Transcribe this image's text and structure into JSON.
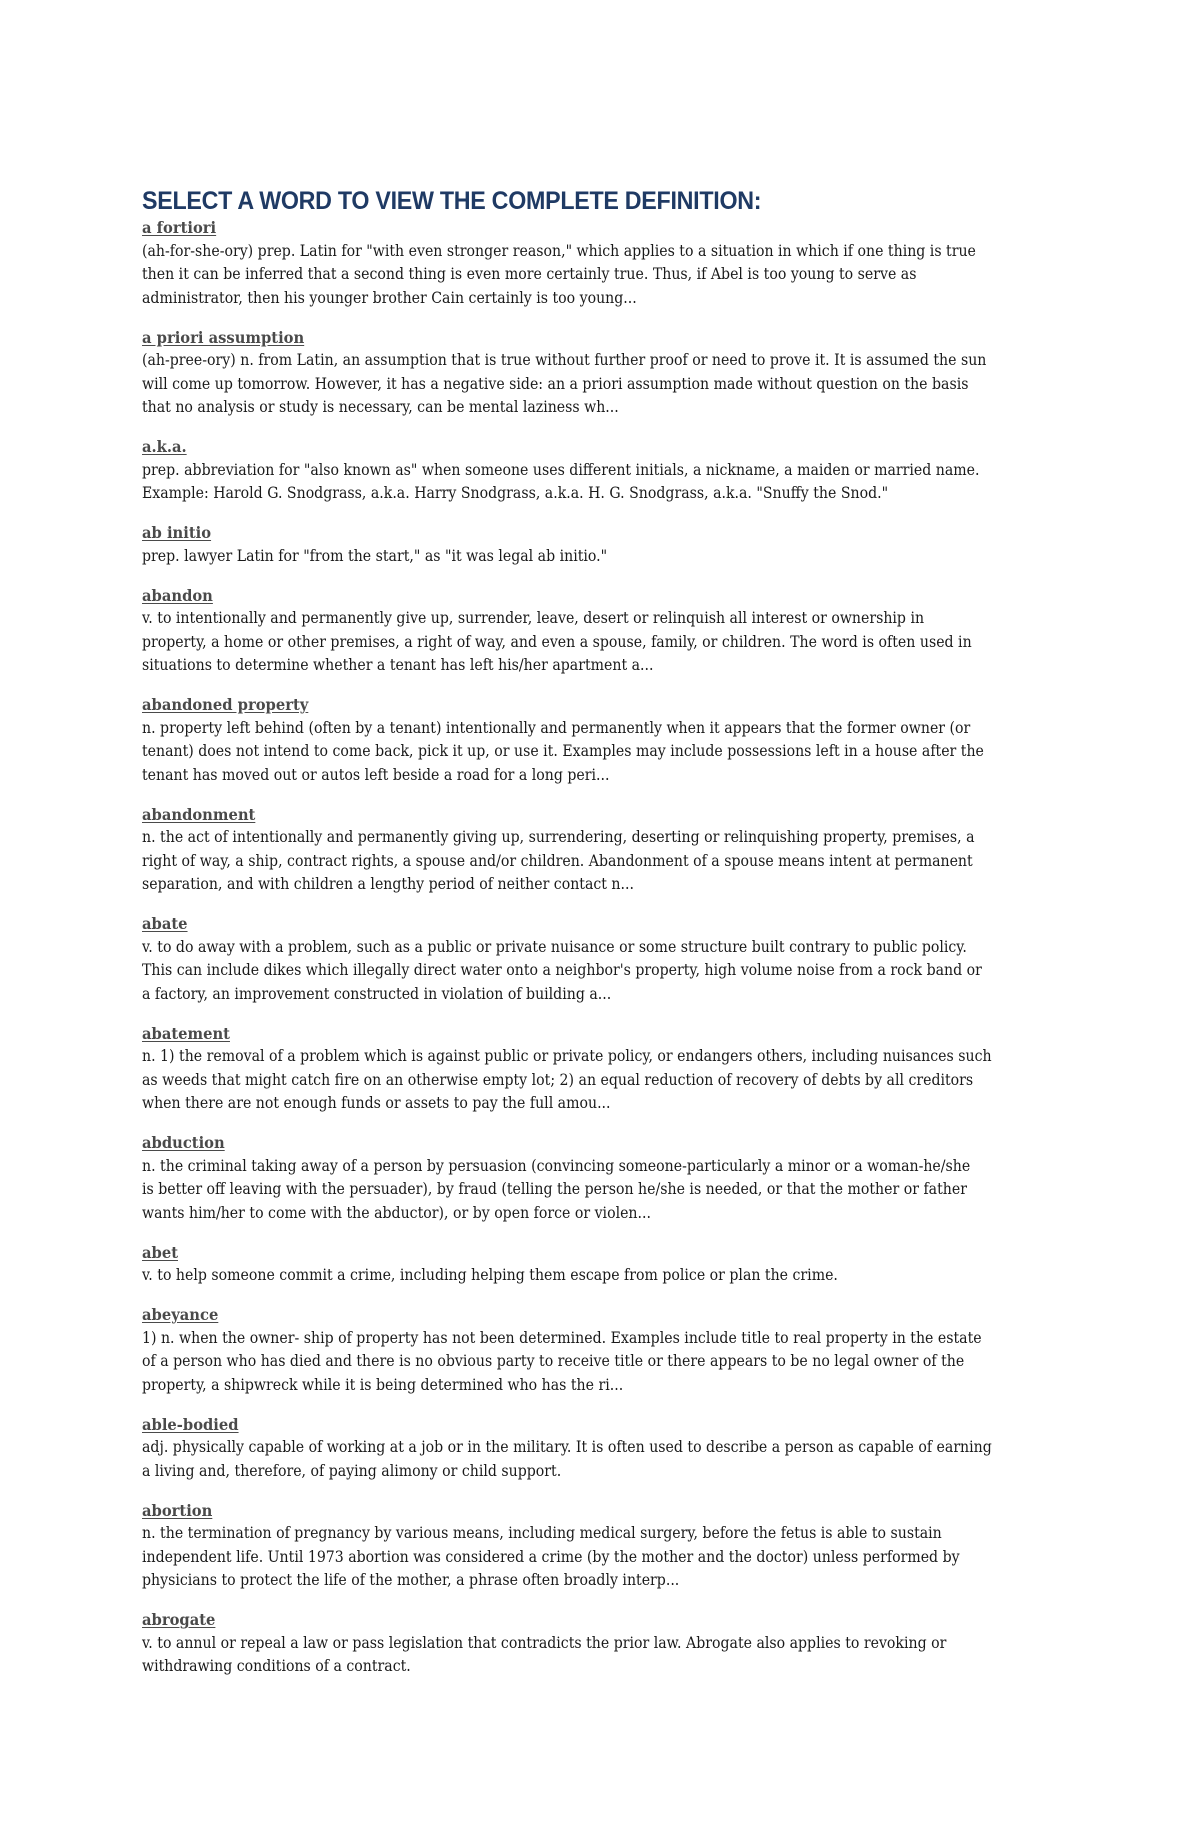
{
  "page": {
    "title": "SELECT A WORD TO VIEW THE COMPLETE DEFINITION:",
    "title_color": "#1f3a64",
    "term_color": "#4a4a4a"
  },
  "entries": [
    {
      "term": "a fortiori",
      "lines": [
        "(ah-for-she-ory) prep. Latin for \"with even stronger reason,\" which applies to a situation in which if one thing is true",
        "then it can be inferred that a second thing is even more certainly true. Thus, if Abel is too young to serve as",
        "administrator, then his younger brother Cain certainly is too young..."
      ]
    },
    {
      "term": "a priori assumption",
      "lines": [
        "(ah-pree-ory) n. from Latin, an assumption that is true without further proof or need to prove it. It is assumed the sun",
        "will come up tomorrow. However, it has a negative side: an a priori assumption made without question on the basis",
        "that no analysis or study is necessary, can be mental laziness wh..."
      ]
    },
    {
      "term": "a.k.a.",
      "lines": [
        "prep. abbreviation for \"also known as\" when someone uses different initials, a nickname, a maiden or married name.",
        "Example: Harold G. Snodgrass, a.k.a. Harry Snodgrass, a.k.a. H. G. Snodgrass, a.k.a. \"Snuffy the Snod.\""
      ]
    },
    {
      "term": "ab initio",
      "lines": [
        "prep. lawyer Latin for \"from the start,\" as \"it was legal ab initio.\""
      ]
    },
    {
      "term": "abandon",
      "lines": [
        "v. to intentionally and permanently give up, surrender, leave, desert or relinquish all interest or ownership in",
        "property, a home or other premises, a right of way, and even a spouse, family, or children. The word is often used in",
        "situations to determine whether a tenant has left his/her apartment a..."
      ]
    },
    {
      "term": "abandoned property",
      "lines": [
        "n. property left behind (often by a tenant) intentionally and permanently when it appears that the former owner (or",
        "tenant) does not intend to come back, pick it up, or use it. Examples may include possessions left in a house after the",
        "tenant has moved out or autos left beside a road for a long peri..."
      ]
    },
    {
      "term": "abandonment",
      "lines": [
        "n. the act of intentionally and permanently giving up, surrendering, deserting or relinquishing property, premises, a",
        "right of way, a ship, contract rights, a spouse and/or children. Abandonment of a spouse means intent at permanent",
        "separation, and with children a lengthy period of neither contact n..."
      ]
    },
    {
      "term": "abate",
      "lines": [
        "v. to do away with a problem, such as a public or private nuisance or some structure built contrary to public policy.",
        "This can include dikes which illegally direct water onto a neighbor's property, high volume noise from a rock band or",
        "a factory, an improvement constructed in violation of building a..."
      ]
    },
    {
      "term": "abatement",
      "lines": [
        "n. 1) the removal of a problem which is against public or private policy, or endangers others, including nuisances such",
        "as weeds that might catch fire on an otherwise empty lot; 2) an equal reduction of recovery of debts by all creditors",
        "when there are not enough funds or assets to pay the full amou..."
      ]
    },
    {
      "term": "abduction",
      "lines": [
        "n. the criminal taking away of a person by persuasion (convincing someone-particularly a minor or a woman-he/she",
        "is better off leaving with the persuader), by fraud (telling the person he/she is needed, or that the mother or father",
        "wants him/her to come with the abductor), or by open force or violen..."
      ]
    },
    {
      "term": "abet",
      "lines": [
        "v. to help someone commit a crime, including helping them escape from police or plan the crime."
      ]
    },
    {
      "term": "abeyance",
      "lines": [
        "1) n. when the owner- ship of property has not been determined. Examples include title to real property in the estate",
        "of a person who has died and there is no obvious party to receive title or there appears to be no legal owner of the",
        "property, a shipwreck while it is being determined who has the ri..."
      ]
    },
    {
      "term": "able-bodied",
      "lines": [
        "adj. physically capable of working at a job or in the military. It is often used to describe a person as capable of earning",
        "a living and, therefore, of paying alimony or child support."
      ]
    },
    {
      "term": "abortion",
      "lines": [
        "n. the termination of pregnancy by various means, including medical surgery, before the fetus is able to sustain",
        "independent life. Until 1973 abortion was considered a crime (by the mother and the doctor) unless performed by",
        "physicians to protect the life of the mother, a phrase often broadly interp..."
      ]
    },
    {
      "term": "abrogate",
      "lines": [
        "v. to annul or repeal a law or pass legislation that contradicts the prior law. Abrogate also applies to revoking or",
        "withdrawing conditions of a contract."
      ]
    }
  ]
}
